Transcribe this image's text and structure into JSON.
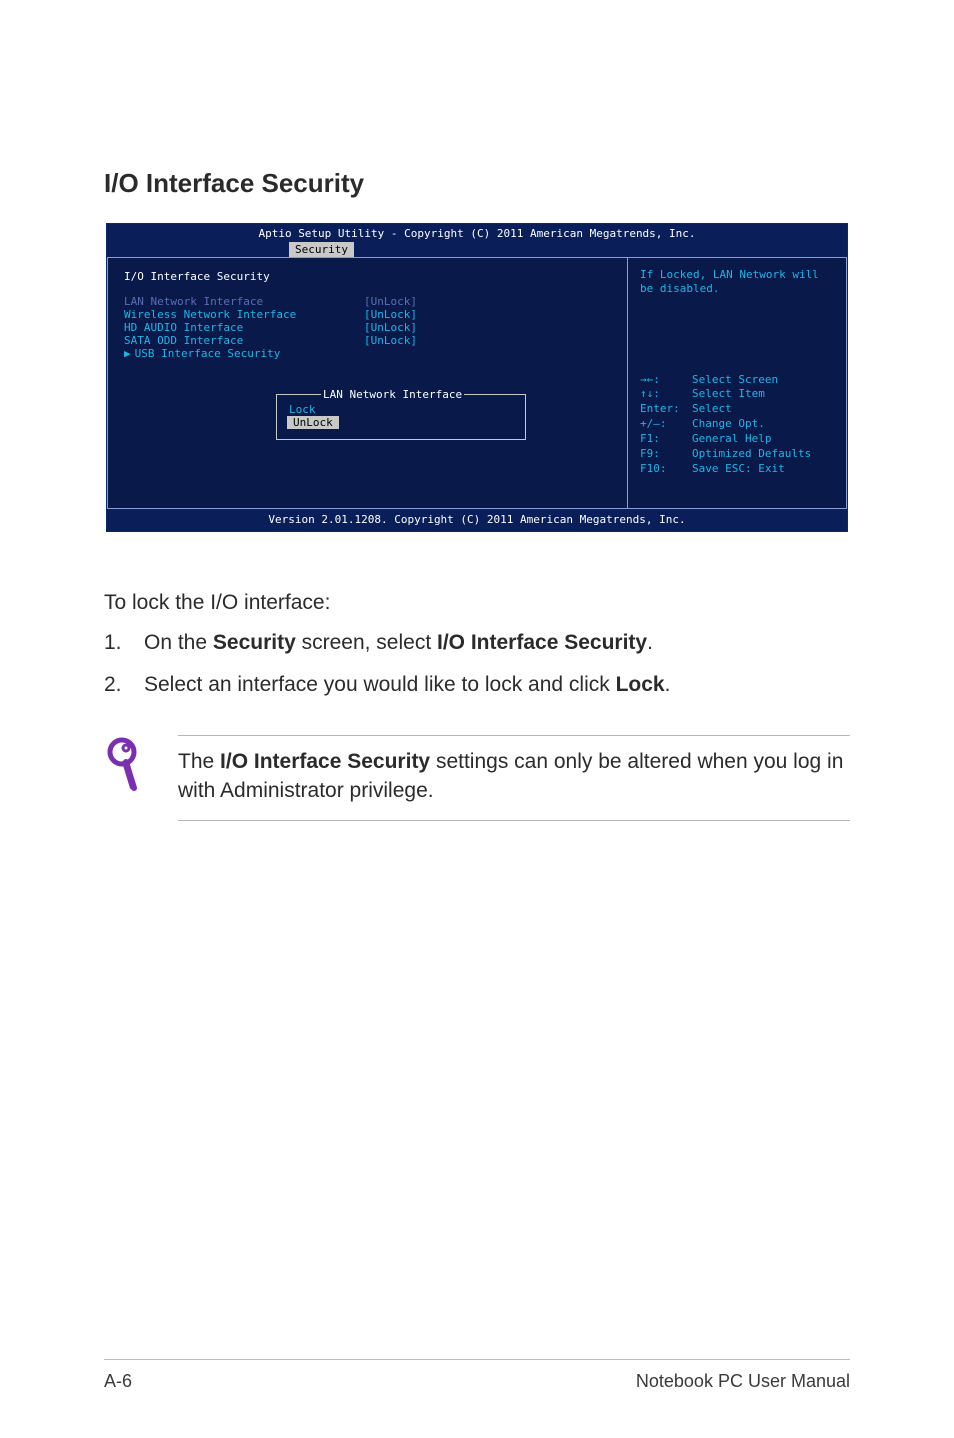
{
  "heading": "I/O Interface Security",
  "bios": {
    "top_line": "Aptio Setup Utility - Copyright (C) 2011 American Megatrends, Inc.",
    "active_tab": "Security",
    "section_title": "I/O Interface Security",
    "rows": [
      {
        "label": "LAN Network Interface",
        "value": "[UnLock]",
        "style": "dim"
      },
      {
        "label": "Wireless Network Interface",
        "value": "[UnLock]",
        "style": "cyan"
      },
      {
        "label": "HD AUDIO Interface",
        "value": "[UnLock]",
        "style": "cyan"
      },
      {
        "label": "SATA ODD Interface",
        "value": "[UnLock]",
        "style": "cyan"
      }
    ],
    "submenu_label": "USB Interface Security",
    "popup": {
      "title": "LAN Network Interface",
      "options": [
        "Lock",
        "UnLock"
      ],
      "selected_index": 1
    },
    "help_desc": "If Locked, LAN Network will be disabled.",
    "key_help": [
      {
        "key": "→←:",
        "desc": "Select Screen"
      },
      {
        "key": "↑↓:",
        "desc": "Select Item"
      },
      {
        "key": "Enter:",
        "desc": "Select"
      },
      {
        "key": "+/—:",
        "desc": "Change Opt."
      },
      {
        "key": "F1:",
        "desc": "General Help"
      },
      {
        "key": "F9:",
        "desc": "Optimized Defaults"
      },
      {
        "key": "F10:",
        "desc": "Save   ESC: Exit"
      }
    ],
    "bottom_line": "Version 2.01.1208. Copyright (C) 2011 American Megatrends, Inc."
  },
  "instructions": {
    "lead": "To lock the I/O interface:",
    "steps": [
      {
        "num": "1.",
        "pre": "On the ",
        "b1": "Security",
        "mid": " screen, select ",
        "b2": "I/O Interface Security",
        "post": "."
      },
      {
        "num": "2.",
        "pre": "Select an interface you would like to lock and click ",
        "b1": "Lock",
        "mid": "",
        "b2": "",
        "post": "."
      }
    ]
  },
  "tip": {
    "pre": "The ",
    "bold": "I/O Interface Security",
    "post": " settings can only be altered when you log in with Administrator privilege."
  },
  "footer": {
    "left": "A-6",
    "right": "Notebook PC User Manual"
  }
}
